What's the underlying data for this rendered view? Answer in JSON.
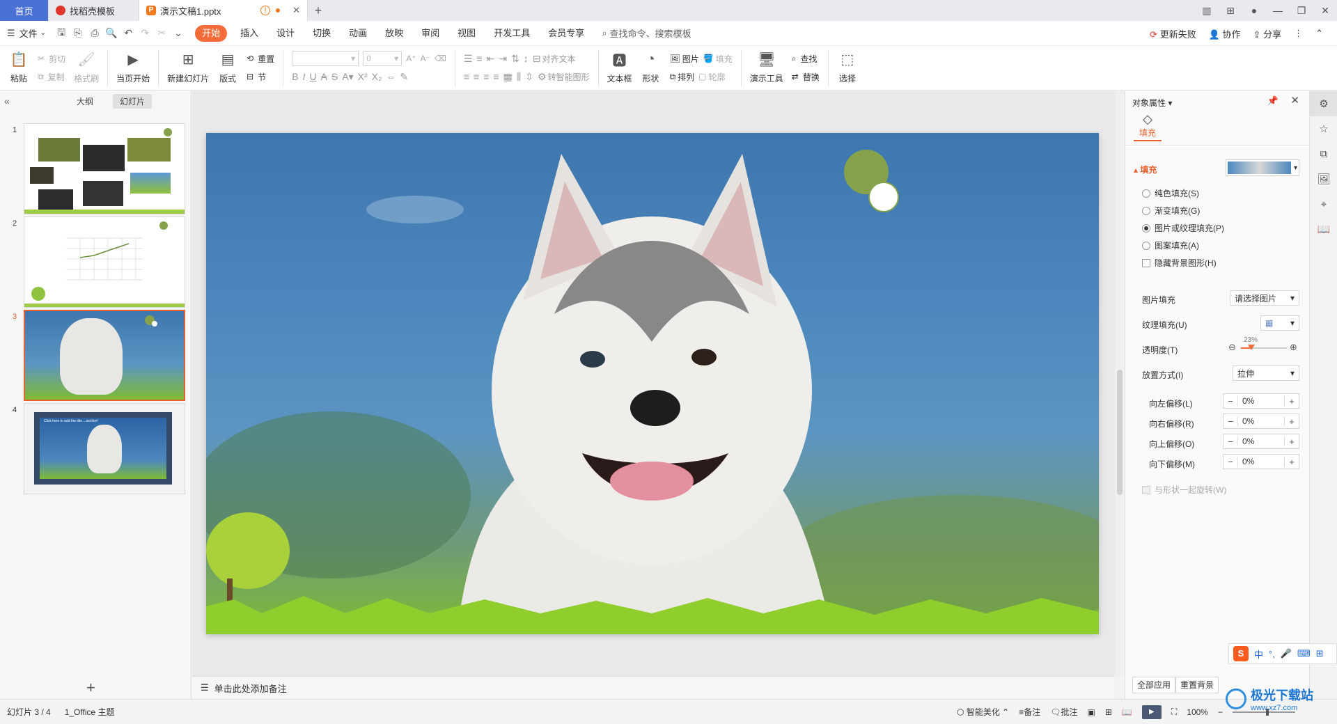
{
  "tabs": {
    "home": "首页",
    "templates": "找稻壳模板",
    "document": "演示文稿1.pptx"
  },
  "menu": {
    "file": "文件",
    "items": [
      "开始",
      "插入",
      "设计",
      "切换",
      "动画",
      "放映",
      "审阅",
      "视图",
      "开发工具",
      "会员专享"
    ],
    "search": "查找命令、搜索模板",
    "update": "更新失败",
    "collab": "协作",
    "share": "分享"
  },
  "ribbon": {
    "paste": "粘贴",
    "cut": "剪切",
    "copy": "复制",
    "format_painter": "格式刷",
    "from_start": "当页开始",
    "new_slide": "新建幻灯片",
    "layout": "版式",
    "reset": "重置",
    "section": "节",
    "font_size": "0",
    "align_text": "对齐文本",
    "to_smart": "转智能图形",
    "textbox": "文本框",
    "shape": "形状",
    "picture": "图片",
    "fill": "填充",
    "arrange": "排列",
    "outline": "轮廓",
    "presenter_tools": "演示工具",
    "find": "查找",
    "replace": "替换",
    "select": "选择"
  },
  "left_panel": {
    "outline_tab": "大纲",
    "slides_tab": "幻灯片",
    "slides": [
      {
        "num": "1"
      },
      {
        "num": "2"
      },
      {
        "num": "3"
      },
      {
        "num": "4",
        "caption": "Click here to add the title ...section!"
      }
    ]
  },
  "notes_placeholder": "单击此处添加备注",
  "right_panel": {
    "title": "对象属性",
    "tab_fill": "填充",
    "section_fill": "填充",
    "options": [
      "纯色填充(S)",
      "渐变填充(G)",
      "图片或纹理填充(P)",
      "图案填充(A)"
    ],
    "selected_option": 2,
    "hide_bg": "隐藏背景图形(H)",
    "picture_fill_label": "图片填充",
    "picture_fill_value": "请选择图片",
    "texture_fill_label": "纹理填充(U)",
    "transparency_label": "透明度(T)",
    "transparency_value": "23%",
    "transparency_fraction": 0.23,
    "placement_label": "放置方式(I)",
    "placement_value": "拉伸",
    "offsets": [
      {
        "label": "向左偏移(L)",
        "value": "0%"
      },
      {
        "label": "向右偏移(R)",
        "value": "0%"
      },
      {
        "label": "向上偏移(O)",
        "value": "0%"
      },
      {
        "label": "向下偏移(M)",
        "value": "0%"
      }
    ],
    "rotate_with_shape": "与形状一起旋转(W)",
    "apply_all": "全部应用",
    "reset_bg": "重置背景"
  },
  "status": {
    "slide_pos": "幻灯片 3 / 4",
    "theme": "1_Office 主题",
    "beautify": "智能美化",
    "notes": "备注",
    "comments": "批注",
    "zoom": "100%"
  },
  "ime": {
    "lang": "中"
  },
  "watermark": {
    "name": "极光下载站",
    "url": "www.xz7.com"
  },
  "colors": {
    "accent": "#f36c39",
    "home_tab": "#4a72d6",
    "selection": "#e8602c",
    "circle_green": "#86a24a"
  }
}
